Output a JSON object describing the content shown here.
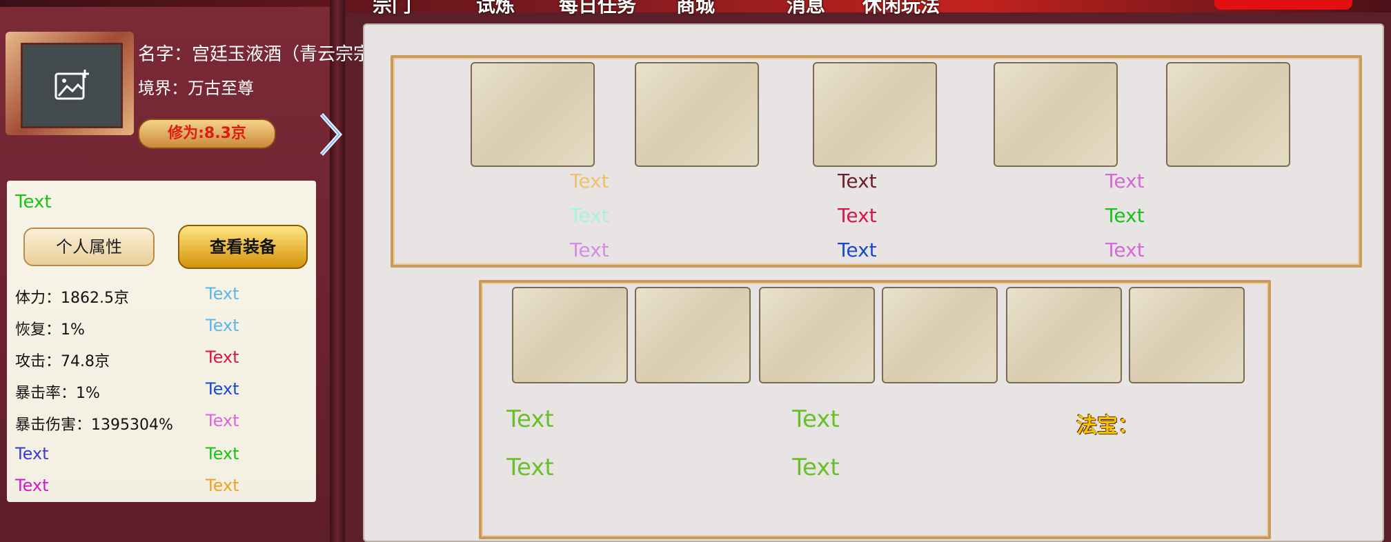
{
  "top_tabs": [
    "宗门",
    "试炼",
    "每日任务",
    "商城",
    "消息",
    "休闲玩法"
  ],
  "profile": {
    "name": "名字：宫廷玉液酒（青云宗宗宗主）",
    "realm": "境界：万古至尊",
    "cultivation": "修为:8.3京"
  },
  "info": {
    "header_text": "Text",
    "buttons": {
      "attributes": "个人属性",
      "equipment": "查看装备"
    },
    "stats": [
      {
        "label": "体力：1862.5京",
        "val": "Text",
        "color": "#5fb6e8"
      },
      {
        "label": "恢复：1%",
        "val": "Text",
        "color": "#5fb6e8"
      },
      {
        "label": "攻击：74.8京",
        "val": "Text",
        "color": "#d6164a"
      },
      {
        "label": "暴击率：1%",
        "val": "Text",
        "color": "#1a48d2"
      },
      {
        "label": "暴击伤害：1395304%",
        "val": "Text",
        "color": "#d36ad8"
      },
      {
        "label": "Text",
        "label_color": "#3b3bd6",
        "val": "Text",
        "color": "#18c318"
      },
      {
        "label": "Text",
        "label_color": "#d018d0",
        "val": "Text",
        "color": "#f0a21f"
      }
    ]
  },
  "main": {
    "upper_cols": [
      [
        "Text",
        "Text",
        "Text"
      ],
      [
        "Text",
        "Text",
        "Text"
      ],
      [
        "Text",
        "Text",
        "Text"
      ]
    ],
    "upper_colors": [
      [
        "#f0c06a",
        "#6b1e2c",
        "#d36ad8"
      ],
      [
        "#a6f3df",
        "#d6164a",
        "#18c318"
      ],
      [
        "#d28ee0",
        "#1a48d2",
        "#d36ad8"
      ]
    ],
    "lower_texts": [
      "Text",
      "Text",
      "Text",
      "Text"
    ],
    "lower_color": "#6cbf2c",
    "fabao_label": "法宝："
  }
}
